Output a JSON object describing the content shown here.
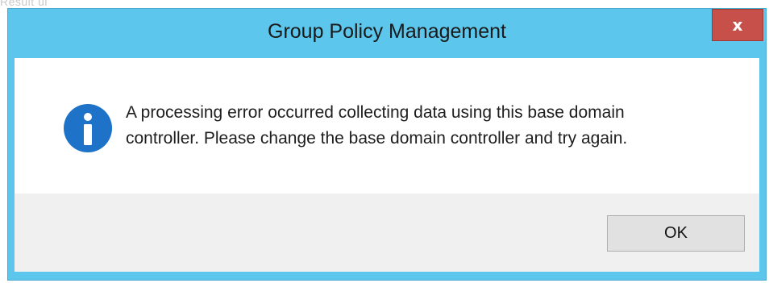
{
  "background": {
    "partial_text": "Result   ui"
  },
  "dialog": {
    "title": "Group Policy Management",
    "close_glyph": "x",
    "message_line1": "A processing error occurred collecting data using this base domain",
    "message_line2": "controller. Please change the base domain controller and try again.",
    "icon": "info-icon",
    "ok_label": "OK"
  },
  "colors": {
    "title_bar": "#5cc6ec",
    "close_button": "#c7504b",
    "content_bg": "#ffffff",
    "button_area_bg": "#f0f0f0",
    "info_icon": "#1e73c8"
  }
}
